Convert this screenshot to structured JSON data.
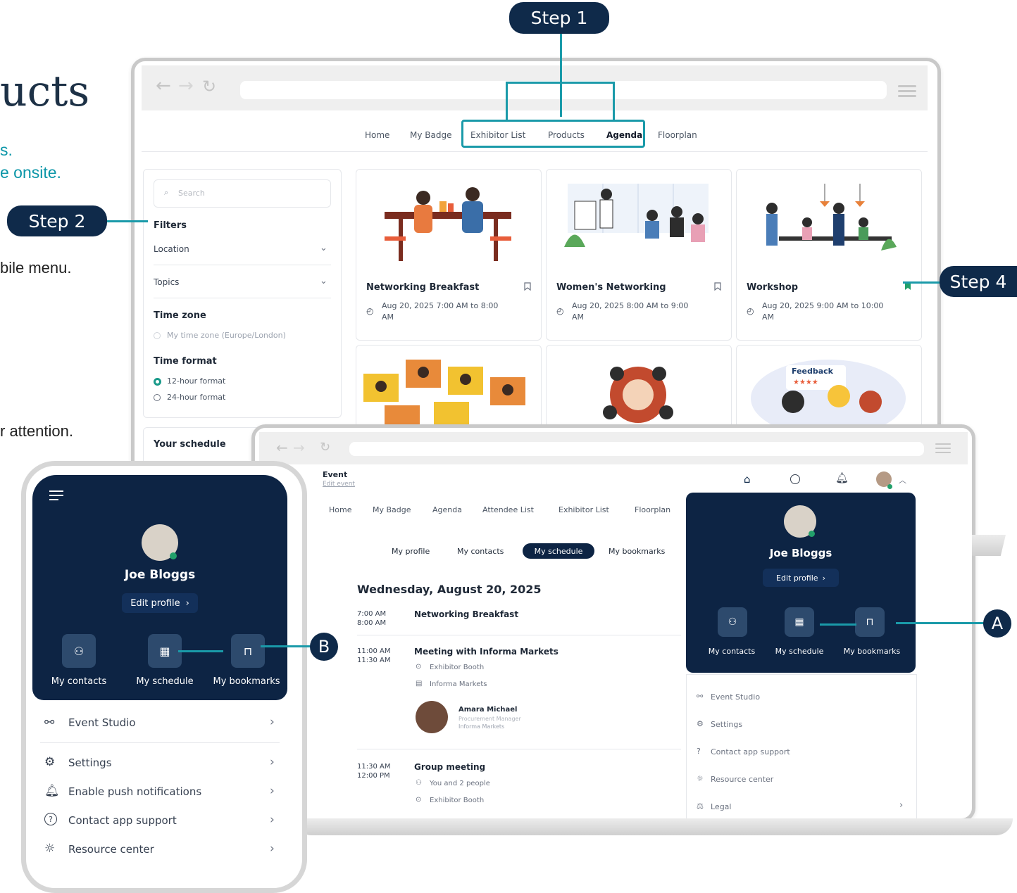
{
  "left_text": {
    "title_fragment": "ucts",
    "teal_line_1": "s.",
    "teal_line_2": "e onsite.",
    "line_mobile_menu": "bile menu.",
    "line_attention": "r attention."
  },
  "callouts": {
    "step1": "Step 1",
    "step2": "Step 2",
    "step4": "Step 4",
    "a": "A",
    "b": "B"
  },
  "agenda_page": {
    "nav_links": [
      "Home",
      "My Badge",
      "Exhibitor List",
      "Products",
      "Agenda",
      "Floorplan"
    ],
    "active_nav": "Agenda",
    "search_placeholder": "Search",
    "filters_heading": "Filters",
    "filter_location": "Location",
    "filter_topics": "Topics",
    "time_zone_heading": "Time zone",
    "time_zone_option": "My time zone (Europe/London)",
    "time_format_heading": "Time format",
    "time_format_options": [
      "12-hour format",
      "24-hour format"
    ],
    "time_format_selected": "12-hour format",
    "your_schedule": "Your schedule",
    "cards": [
      {
        "title": "Networking Breakfast",
        "time_line1": "Aug 20, 2025 7:00 AM to 8:00",
        "time_line2": "AM",
        "bookmarked": false
      },
      {
        "title": "Women's Networking",
        "time_line1": "Aug 20, 2025 8:00 AM to 9:00",
        "time_line2": "AM",
        "bookmarked": false
      },
      {
        "title": "Workshop",
        "time_line1": "Aug 20, 2025 9:00 AM to 10:00",
        "time_line2": "AM",
        "bookmarked": true
      }
    ],
    "feedback_label": "Feedback"
  },
  "schedule_page": {
    "event_label": "Event",
    "edit_event": "Edit event",
    "nav_links": [
      "Home",
      "My Badge",
      "Agenda",
      "Attendee List",
      "Exhibitor List",
      "Floorplan"
    ],
    "sub_tabs": [
      "My profile",
      "My contacts",
      "My schedule",
      "My bookmarks"
    ],
    "active_sub_tab": "My schedule",
    "date_heading": "Wednesday, August 20, 2025",
    "sessions": [
      {
        "start": "7:00 AM",
        "end": "8:00 AM",
        "title": "Networking Breakfast"
      },
      {
        "start": "11:00 AM",
        "end": "11:30 AM",
        "title": "Meeting with Informa Markets",
        "location": "Exhibitor Booth",
        "company": "Informa Markets",
        "person_name": "Amara Michael",
        "person_role": "Procurement Manager",
        "person_company": "Informa Markets"
      },
      {
        "start": "11:30 AM",
        "end": "12:00 PM",
        "title": "Group meeting",
        "attendees": "You and 2 people",
        "location": "Exhibitor Booth"
      }
    ]
  },
  "desktop_profile_menu": {
    "name": "Joe Bloggs",
    "edit_profile": "Edit profile",
    "actions": [
      "My contacts",
      "My schedule",
      "My bookmarks"
    ],
    "items": [
      "Event Studio",
      "Settings",
      "Contact app support",
      "Resource center",
      "Legal"
    ]
  },
  "mobile_profile_menu": {
    "name": "Joe Bloggs",
    "edit_profile": "Edit profile",
    "actions": [
      "My contacts",
      "My schedule",
      "My bookmarks"
    ],
    "items": [
      "Event Studio",
      "Settings",
      "Enable push notifications",
      "Contact app support",
      "Resource center"
    ]
  },
  "colors": {
    "navy": "#0f2a4a",
    "teal": "#1a9aa9",
    "panel_navy": "#0d2444",
    "bookmark_green": "#22a06b"
  }
}
